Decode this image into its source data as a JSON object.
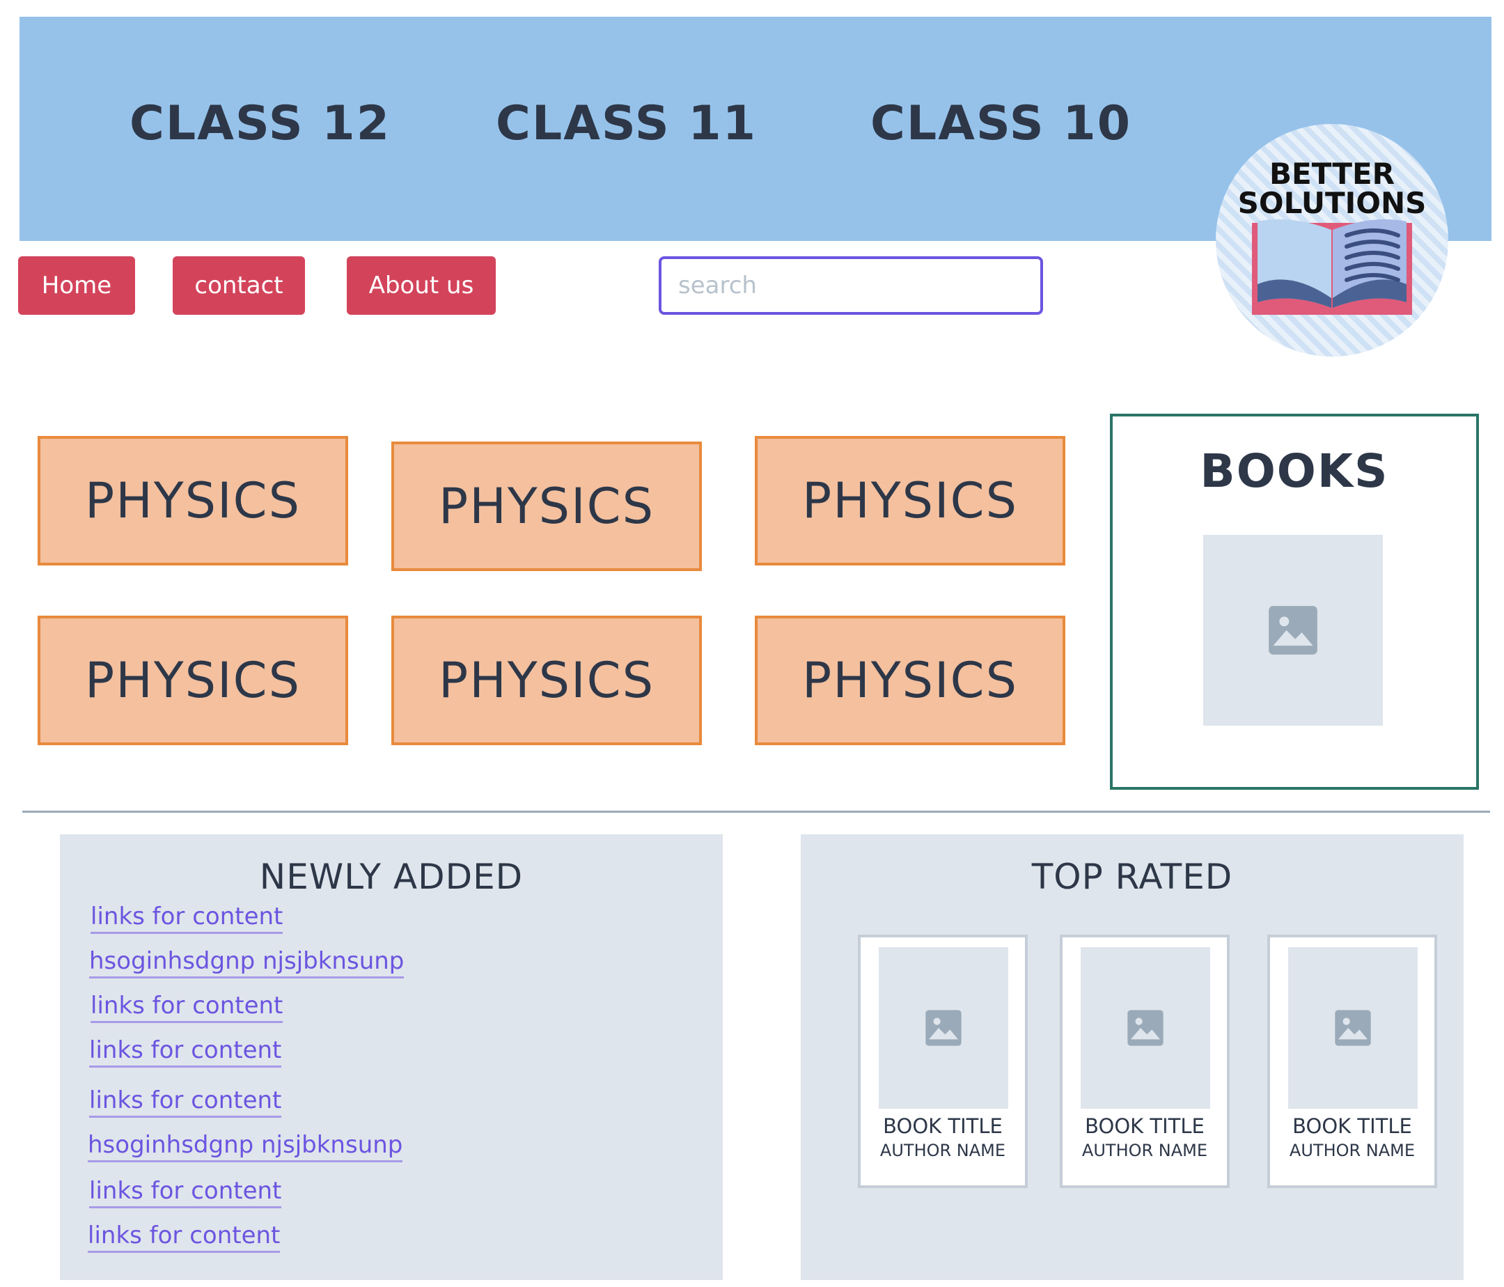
{
  "header": {
    "classes": [
      "CLASS 12",
      "CLASS 11",
      "CLASS 10"
    ]
  },
  "logo": {
    "line1": "BETTER",
    "line2": "SOLUTIONS"
  },
  "nav": {
    "home": "Home",
    "contact": "contact",
    "about": "About us"
  },
  "search": {
    "placeholder": "search"
  },
  "subjects": [
    "PHYSICS",
    "PHYSICS",
    "PHYSICS",
    "PHYSICS",
    "PHYSICS",
    "PHYSICS"
  ],
  "books_panel": {
    "title": "BOOKS",
    "image_icon": "image-icon"
  },
  "newly_added": {
    "title": "NEWLY ADDED",
    "links": [
      "links for content",
      "hsoginhsdgnp njsjbknsunp",
      "links for content",
      "links for content",
      "links for content",
      "hsoginhsdgnp njsjbknsunp",
      "links for content",
      "links for content"
    ]
  },
  "top_rated": {
    "title": "TOP RATED",
    "books": [
      {
        "title": "BOOK TITLE",
        "author": "AUTHOR NAME"
      },
      {
        "title": "BOOK TITLE",
        "author": "AUTHOR NAME"
      },
      {
        "title": "BOOK TITLE",
        "author": "AUTHOR NAME"
      }
    ]
  },
  "colors": {
    "header_bg": "#96c2ea",
    "nav_button": "#d3445b",
    "search_border": "#6b55e0",
    "subject_fill": "#f4c09e",
    "subject_border": "#e88a3c",
    "books_border": "#2a7566",
    "panel_bg": "#dfe5ec",
    "link": "#6b55e0"
  }
}
